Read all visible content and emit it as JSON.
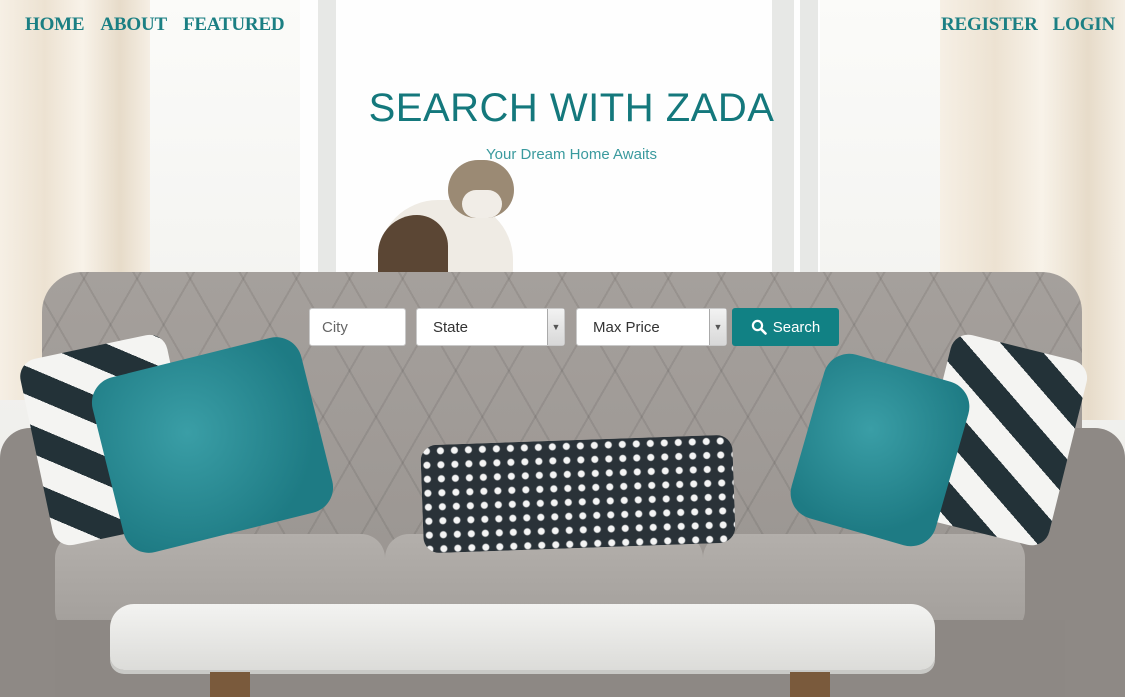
{
  "nav": {
    "left": [
      "HOME",
      "ABOUT",
      "FEATURED"
    ],
    "right": [
      "REGISTER",
      "LOGIN"
    ]
  },
  "hero": {
    "title": "SEARCH WITH ZADA",
    "subtitle": "Your Dream Home Awaits"
  },
  "search": {
    "city_placeholder": "City",
    "state_selected": "State",
    "price_selected": "Max Price",
    "button_label": "Search",
    "button_icon": "search-icon"
  },
  "colors": {
    "accent": "#1b7f83",
    "button": "#118184",
    "subtitle": "#3a9a9e"
  }
}
